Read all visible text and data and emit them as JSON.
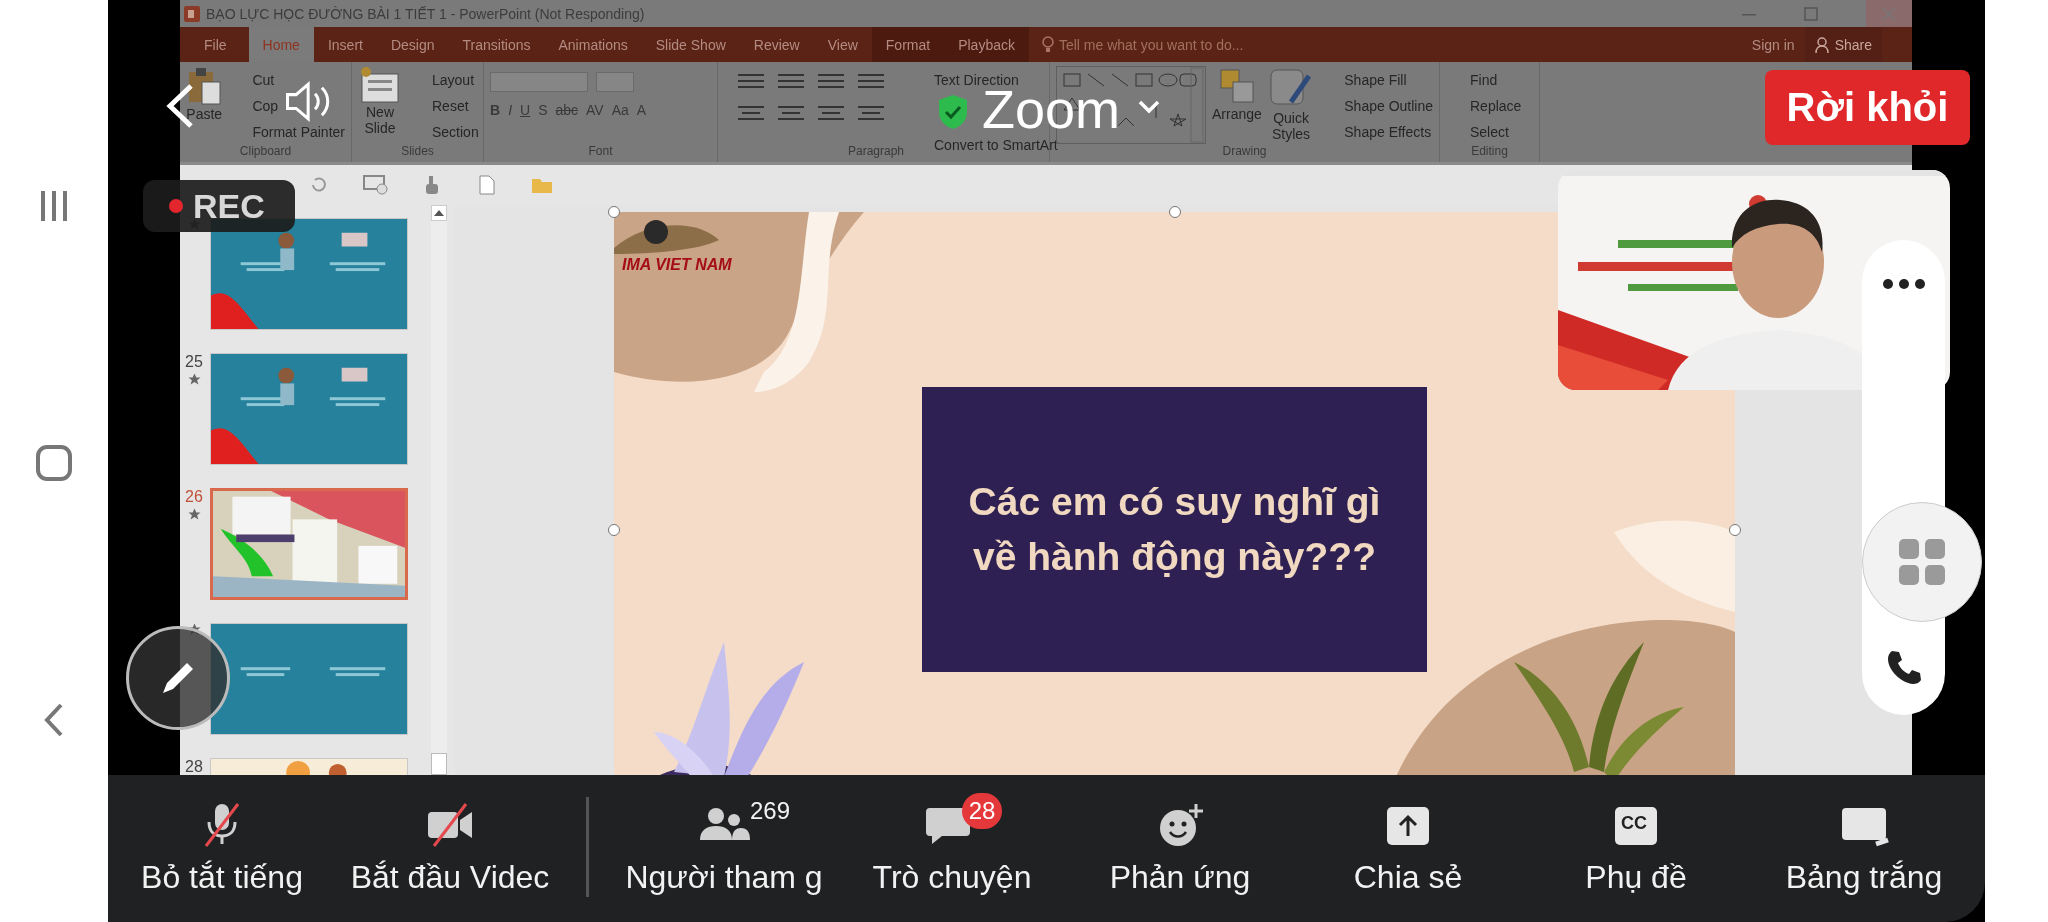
{
  "zoom_header": {
    "title": "Zoom",
    "leave_button": "Rời khỏi",
    "recording": "REC"
  },
  "powerpoint": {
    "title": "BẠO LỰC HỌC ĐƯỜNG  BÀI 1 TIẾT 1 - PowerPoint (Not Responding)",
    "tabs": [
      {
        "label": "File",
        "selected": false,
        "contextual": false
      },
      {
        "label": "Home",
        "selected": true,
        "contextual": false
      },
      {
        "label": "Insert",
        "selected": false,
        "contextual": false
      },
      {
        "label": "Design",
        "selected": false,
        "contextual": false
      },
      {
        "label": "Transitions",
        "selected": false,
        "contextual": false
      },
      {
        "label": "Animations",
        "selected": false,
        "contextual": false
      },
      {
        "label": "Slide Show",
        "selected": false,
        "contextual": false
      },
      {
        "label": "Review",
        "selected": false,
        "contextual": false
      },
      {
        "label": "View",
        "selected": false,
        "contextual": false
      },
      {
        "label": "Format",
        "selected": false,
        "contextual": true
      },
      {
        "label": "Playback",
        "selected": false,
        "contextual": true
      }
    ],
    "tell_me": "Tell me what you want to do...",
    "sign_in": "Sign in",
    "share": "Share",
    "ribbon": [
      {
        "kind": "clipboard",
        "label": "Clipboard",
        "large": [
          "Paste"
        ],
        "small": [
          "Cut",
          "Cop",
          "Format Painter"
        ]
      },
      {
        "kind": "slides",
        "label": "Slides",
        "large": [
          "New Slide"
        ],
        "small": [
          "Layout",
          "Reset",
          "Section"
        ]
      },
      {
        "kind": "font",
        "label": "Font",
        "buttons": [
          "B",
          "I",
          "U",
          "S",
          "abc",
          "AV",
          "Aa",
          "A"
        ]
      },
      {
        "kind": "paragraph",
        "label": "Paragraph",
        "small": [
          "Text Direction",
          "Convert to SmartArt"
        ]
      },
      {
        "kind": "drawing",
        "label": "Drawing",
        "large": [
          "Arrange",
          "Quick Styles"
        ],
        "small": [
          "Shape Fill",
          "Shape Outline",
          "Shape Effects"
        ]
      },
      {
        "kind": "editing",
        "label": "Editing",
        "small": [
          "Find",
          "Replace",
          "Select"
        ]
      }
    ],
    "thumbnails": [
      {
        "kind": "teal-red-corner",
        "selected": false
      },
      {
        "number": "25",
        "kind": "teal-red-corner",
        "selected": false
      },
      {
        "number": "26",
        "kind": "scene",
        "selected": true
      },
      {
        "kind": "teal",
        "selected": false
      },
      {
        "number": "28",
        "kind": "cream",
        "selected": false
      }
    ],
    "slide": {
      "logo": "IMA VIET NAM",
      "question": "Các em có suy nghĩ gì về hành động này???"
    }
  },
  "toolbar": [
    {
      "kind": "microphone",
      "label": "Bỏ tắt tiếng",
      "off": true
    },
    {
      "kind": "video",
      "label": "Bắt đầu Videc",
      "off": true
    },
    {
      "kind": "participants",
      "label": "Người tham g",
      "off": false,
      "count": "269"
    },
    {
      "kind": "chat",
      "label": "Trò chuyện",
      "off": false,
      "badge": "28"
    },
    {
      "kind": "reactions",
      "label": "Phản ứng",
      "off": false
    },
    {
      "kind": "share",
      "label": "Chia sẻ",
      "off": false
    },
    {
      "kind": "captions",
      "label": "Phụ đề",
      "off": false,
      "icon_text": "CC"
    },
    {
      "kind": "whiteboard",
      "label": "Bảng trắng",
      "off": false
    }
  ]
}
